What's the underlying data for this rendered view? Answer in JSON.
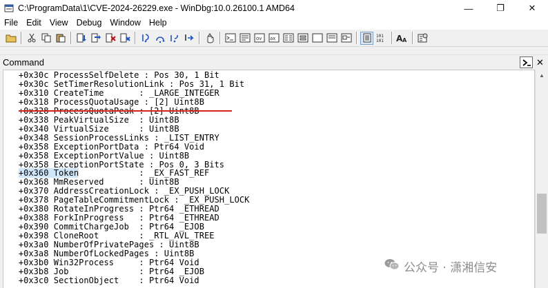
{
  "window": {
    "title": "C:\\ProgramData\\1\\CVE-2024-26229.exe - WinDbg:10.0.26100.1 AMD64",
    "minimize_glyph": "—",
    "restore_glyph": "❐",
    "close_glyph": "✕"
  },
  "menu": {
    "items": [
      "File",
      "Edit",
      "View",
      "Debug",
      "Window",
      "Help"
    ]
  },
  "command_pane": {
    "title": "Command",
    "close_glyph": "✕"
  },
  "output": {
    "lines": [
      "   +0x30c ProcessSelfDelete : Pos 30, 1 Bit",
      "   +0x30c SetTimerResolutionLink : Pos 31, 1 Bit",
      "   +0x310 CreateTime       : _LARGE_INTEGER",
      "   +0x318 ProcessQuotaUsage : [2] Uint8B",
      "   +0x328 ProcessQuotaPeak : [2] Uint8B",
      "   +0x338 PeakVirtualSize  : Uint8B",
      "   +0x340 VirtualSize      : Uint8B",
      "   +0x348 SessionProcessLinks : _LIST_ENTRY",
      "   +0x358 ExceptionPortData : Ptr64 Void",
      "   +0x358 ExceptionPortValue : Uint8B",
      "   +0x358 ExceptionPortState : Pos 0, 3 Bits",
      "   +0x360 Token            : _EX_FAST_REF",
      "   +0x368 MmReserved       : Uint8B",
      "   +0x370 AddressCreationLock : _EX_PUSH_LOCK",
      "   +0x378 PageTableCommitmentLock : _EX_PUSH_LOCK",
      "   +0x380 RotateInProgress : Ptr64 _ETHREAD",
      "   +0x388 ForkInProgress   : Ptr64 _ETHREAD",
      "   +0x390 CommitChargeJob  : Ptr64 _EJOB",
      "   +0x398 CloneRoot        : _RTL_AVL_TREE",
      "   +0x3a0 NumberOfPrivatePages : Uint8B",
      "   +0x3a8 NumberOfLockedPages : Uint8B",
      "   +0x3b0 Win32Process     : Ptr64 Void",
      "   +0x3b8 Job              : Ptr64 _EJOB",
      "   +0x3c0 SectionObject    : Ptr64 Void"
    ],
    "highlighted_text": "+0x360 Token"
  },
  "watermark": {
    "text": "公众号 · 潇湘信安"
  },
  "colors": {
    "highlight": "#cfe6fb",
    "annotation_underline": "#d0231a"
  }
}
